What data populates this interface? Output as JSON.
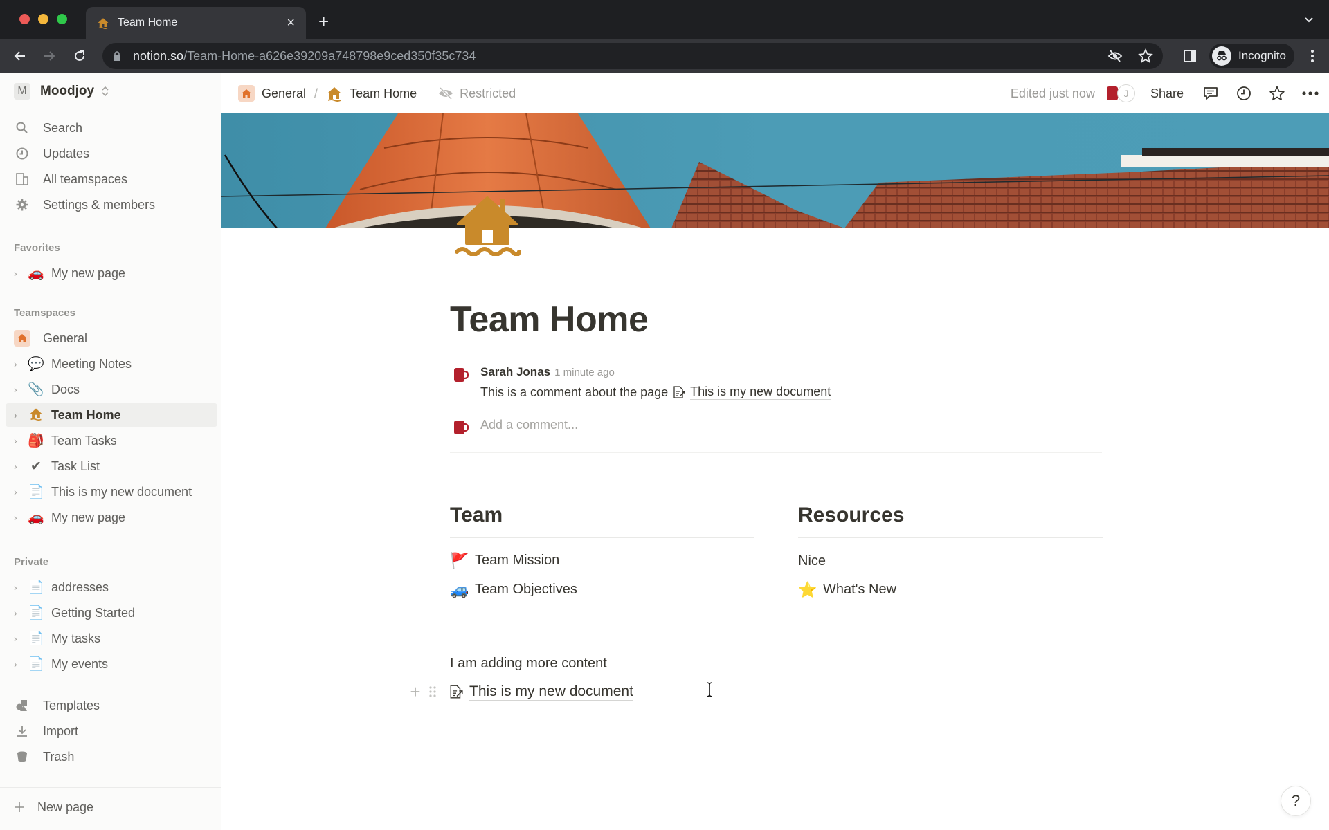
{
  "browser": {
    "tab_title": "Team Home",
    "url_host": "notion.so",
    "url_path": "/Team-Home-a626e39209a748798e9ced350f35c734",
    "profile_label": "Incognito"
  },
  "sidebar": {
    "workspace_initial": "M",
    "workspace_name": "Moodjoy",
    "nav": [
      {
        "label": "Search",
        "icon": "search-icon"
      },
      {
        "label": "Updates",
        "icon": "clock-icon"
      },
      {
        "label": "All teamspaces",
        "icon": "building-icon"
      },
      {
        "label": "Settings & members",
        "icon": "gear-icon"
      }
    ],
    "favorites_heading": "Favorites",
    "favorites": [
      {
        "label": "My new page",
        "emoji": "🚗"
      }
    ],
    "teamspaces_heading": "Teamspaces",
    "teamspace_name": "General",
    "teamspace_pages": [
      {
        "label": "Meeting Notes",
        "emoji": "💬"
      },
      {
        "label": "Docs",
        "emoji": "📎"
      },
      {
        "label": "Team Home",
        "emoji": "🏠",
        "active": true
      },
      {
        "label": "Team Tasks",
        "emoji": "🎒"
      },
      {
        "label": "Task List",
        "emoji": "✔"
      },
      {
        "label": "This is my new document",
        "emoji": "📄"
      },
      {
        "label": "My new page",
        "emoji": "🚗"
      }
    ],
    "private_heading": "Private",
    "private_pages": [
      {
        "label": "addresses",
        "emoji": "📄"
      },
      {
        "label": "Getting Started",
        "emoji": "📄"
      },
      {
        "label": "My tasks",
        "emoji": "📄"
      },
      {
        "label": "My events",
        "emoji": "📄"
      }
    ],
    "bottom": [
      {
        "label": "Templates",
        "icon": "templates-icon"
      },
      {
        "label": "Import",
        "icon": "import-icon"
      },
      {
        "label": "Trash",
        "icon": "trash-icon"
      }
    ],
    "new_page_label": "New page"
  },
  "topbar": {
    "breadcrumb": [
      {
        "label": "General"
      },
      {
        "label": "Team Home"
      }
    ],
    "separator": "/",
    "restricted_label": "Restricted",
    "edited_label": "Edited just now",
    "collaborator_initial": "J",
    "share_label": "Share"
  },
  "page": {
    "title": "Team Home",
    "comment": {
      "author": "Sarah Jonas",
      "time": "1 minute ago",
      "body": "This is a comment about the page",
      "mention": "This is my new document"
    },
    "add_comment_placeholder": "Add a comment...",
    "columns": [
      {
        "heading": "Team",
        "items": [
          {
            "label": "Team Mission",
            "emoji": "🚩",
            "link": true
          },
          {
            "label": "Team Objectives",
            "emoji": "🚙",
            "link": true
          }
        ]
      },
      {
        "heading": "Resources",
        "items": [
          {
            "label": "Nice",
            "emoji": "",
            "link": false
          },
          {
            "label": "What's New",
            "emoji": "⭐",
            "link": true
          }
        ]
      }
    ],
    "more_text": "I am adding more content",
    "doc_link": "This is my new document"
  },
  "help_label": "?",
  "colors": {
    "accent_house": "#c98a2b",
    "teamspace_badge": "#f7d7c4",
    "text_primary": "#37352f",
    "text_muted": "#9b9a97"
  }
}
